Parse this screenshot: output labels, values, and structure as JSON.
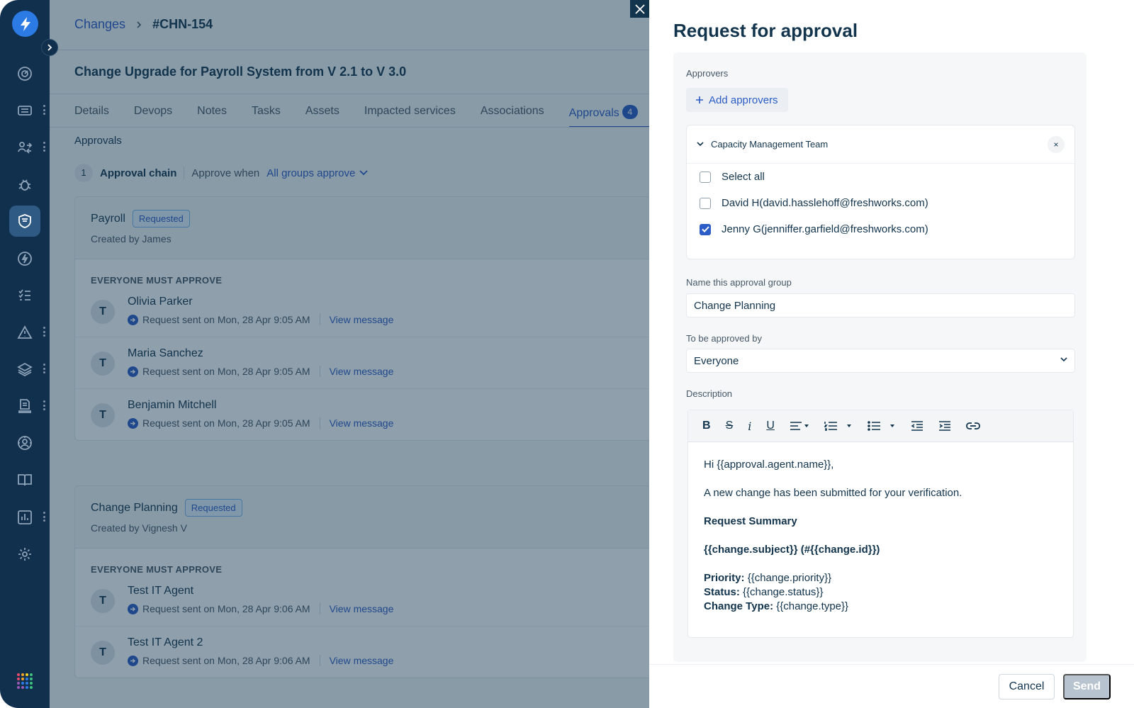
{
  "breadcrumb": {
    "parent": "Changes",
    "current": "#CHN-154"
  },
  "change_title": "Change Upgrade for Payroll System from V 2.1 to V 3.0",
  "tabs": [
    {
      "label": "Details"
    },
    {
      "label": "Devops"
    },
    {
      "label": "Notes"
    },
    {
      "label": "Tasks"
    },
    {
      "label": "Assets"
    },
    {
      "label": "Impacted services"
    },
    {
      "label": "Associations"
    },
    {
      "label": "Approvals",
      "badge": "4",
      "active": true
    }
  ],
  "approvals": {
    "section_title": "Approvals",
    "chain_number": "1",
    "chain_label": "Approval chain",
    "approve_when_label": "Approve when",
    "approve_when_value": "All groups approve",
    "groups": [
      {
        "name": "Payroll",
        "status": "Requested",
        "created_by": "Created by James",
        "rule": "EVERYONE MUST APPROVE",
        "approvers": [
          {
            "initial": "T",
            "name": "Olivia Parker",
            "sent": "Request sent on Mon, 28 Apr 9:05 AM",
            "link": "View message"
          },
          {
            "initial": "T",
            "name": "Maria Sanchez",
            "sent": "Request sent on Mon, 28 Apr 9:05 AM",
            "link": "View message"
          },
          {
            "initial": "T",
            "name": "Benjamin Mitchell",
            "sent": "Request sent on Mon, 28 Apr 9:05 AM",
            "link": "View message"
          }
        ]
      },
      {
        "name": "Change Planning",
        "status": "Requested",
        "created_by": "Created by Vignesh V",
        "rule": "EVERYONE MUST APPROVE",
        "approvers": [
          {
            "initial": "T",
            "name": "Test IT Agent",
            "sent": "Request sent on Mon, 28 Apr 9:06 AM",
            "link": "View message"
          },
          {
            "initial": "T",
            "name": "Test IT Agent 2",
            "sent": "Request sent on Mon, 28 Apr 9:06 AM",
            "link": "View message"
          }
        ]
      }
    ]
  },
  "panel": {
    "title": "Request for approval",
    "approvers_label": "Approvers",
    "add_approvers": "Add approvers",
    "team": {
      "name": "Capacity Management Team",
      "remove": "×",
      "options": [
        {
          "label": "Select all",
          "checked": false
        },
        {
          "label": "David H(david.hasslehoff@freshworks.com)",
          "checked": false
        },
        {
          "label": "Jenny G(jenniffer.garfield@freshworks.com)",
          "checked": true
        }
      ]
    },
    "group_name_label": "Name this approval group",
    "group_name_value": "Change Planning",
    "approved_by_label": "To be approved by",
    "approved_by_value": "Everyone",
    "description_label": "Description",
    "toolbar": [
      "bold",
      "strikethrough",
      "italic",
      "underline",
      "align",
      "ordered-list",
      "unordered-list",
      "outdent",
      "indent",
      "link"
    ],
    "description": {
      "greeting": "Hi {{approval.agent.name}},",
      "intro": "A new change has been submitted for your verification.",
      "summary_heading": "Request Summary",
      "subject_line": "{{change.subject}} (#{{change.id}})",
      "priority_label": "Priority:",
      "priority_value": "{{change.priority}}",
      "status_label": "Status:",
      "status_value": "{{change.status}}",
      "type_label": "Change Type:",
      "type_value": "{{change.type}}"
    },
    "cancel": "Cancel",
    "send": "Send"
  },
  "colors": {
    "accent": "#2c5cc5",
    "nav": "#11304d",
    "overlay": "rgba(18,52,77,0.47)"
  }
}
